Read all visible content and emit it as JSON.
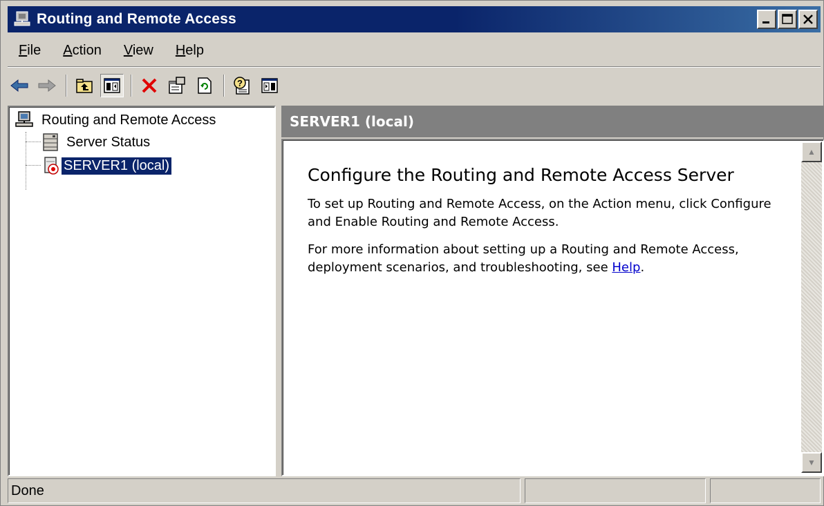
{
  "window": {
    "title": "Routing and Remote Access",
    "controls": [
      "minimize",
      "maximize",
      "close"
    ]
  },
  "menu": {
    "items": [
      {
        "label": "File",
        "accel": "F",
        "rest": "ile"
      },
      {
        "label": "Action",
        "accel": "A",
        "rest": "ction"
      },
      {
        "label": "View",
        "accel": "V",
        "rest": "iew"
      },
      {
        "label": "Help",
        "accel": "H",
        "rest": "elp"
      }
    ]
  },
  "toolbar": {
    "buttons": [
      "back-arrow-icon",
      "forward-arrow-icon",
      "up-one-level-icon",
      "show-hide-tree-icon",
      "delete-icon",
      "properties-icon",
      "refresh-icon",
      "help-icon",
      "show-hide-action-pane-icon"
    ],
    "pressed": "show-hide-tree-icon"
  },
  "tree": {
    "root": "Routing and Remote Access",
    "children": [
      {
        "label": "Server Status",
        "selected": false
      },
      {
        "label": "SERVER1 (local)",
        "selected": true
      }
    ]
  },
  "details": {
    "header": "SERVER1 (local)",
    "heading": "Configure the Routing and Remote Access Server",
    "paragraph1": "To set up Routing and Remote Access, on the Action menu, click Configure and Enable Routing and Remote Access.",
    "paragraph2_prefix": "For more information about setting up a Routing and Remote Access, deployment scenarios, and troubleshooting, see ",
    "help_link": "Help",
    "paragraph2_suffix": "."
  },
  "status": {
    "text": "Done",
    "panel2": "",
    "panel3": ""
  },
  "colors": {
    "titlebar": "#0a246a",
    "selection": "#0a246a",
    "link": "#0000cc",
    "delete_icon": "#e00000"
  }
}
